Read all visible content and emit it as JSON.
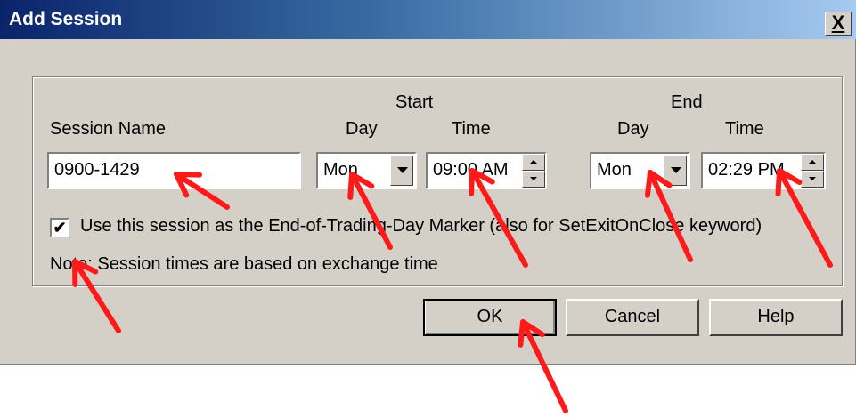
{
  "window": {
    "title": "Add Session",
    "close_glyph": "X"
  },
  "headers": {
    "start": "Start",
    "end": "End",
    "session_name": "Session Name",
    "start_day": "Day",
    "start_time": "Time",
    "end_day": "Day",
    "end_time": "Time"
  },
  "fields": {
    "session_name_value": "0900-1429",
    "start_day_value": "Mon",
    "start_time_value": "09:00 AM",
    "end_day_value": "Mon",
    "end_time_value": "02:29 PM"
  },
  "checkbox": {
    "checked": true,
    "mark": "✔",
    "label": "Use this session as the End-of-Trading-Day Marker (also for SetExitOnClose keyword)"
  },
  "note": "Note: Session times are based on exchange time",
  "buttons": {
    "ok": "OK",
    "cancel": "Cancel",
    "help": "Help"
  },
  "annotation_color": "#ff1a1a"
}
